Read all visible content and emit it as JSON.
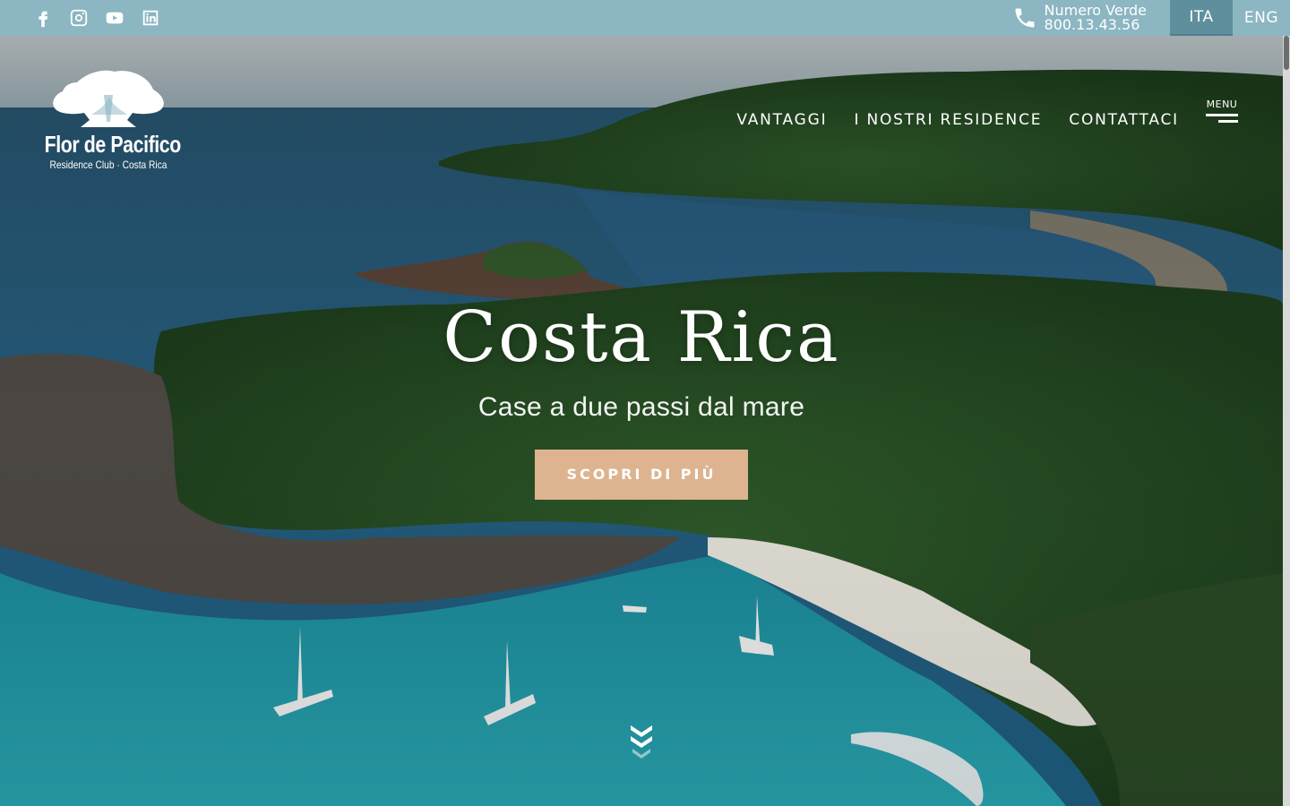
{
  "topbar": {
    "social": [
      "facebook-icon",
      "instagram-icon",
      "youtube-icon",
      "linkedin-icon"
    ],
    "phone_label": "Numero Verde",
    "phone_number": "800.13.43.56",
    "lang_ita": "ITA",
    "lang_eng": "ENG"
  },
  "logo": {
    "brand": "Flor de Pacifico",
    "tagline": "Residence Club · Costa Rica"
  },
  "nav": {
    "items": [
      "VANTAGGI",
      "I NOSTRI RESIDENCE",
      "CONTATTACI"
    ],
    "menu_label": "MENU"
  },
  "hero": {
    "title": "Costa Rica",
    "subtitle": "Case a due passi dal mare",
    "cta": "SCOPRI DI PIÙ"
  },
  "colors": {
    "topbar": "#8bb6c2",
    "lang_active": "#5f8f9c",
    "cta": "#ddb48f"
  }
}
